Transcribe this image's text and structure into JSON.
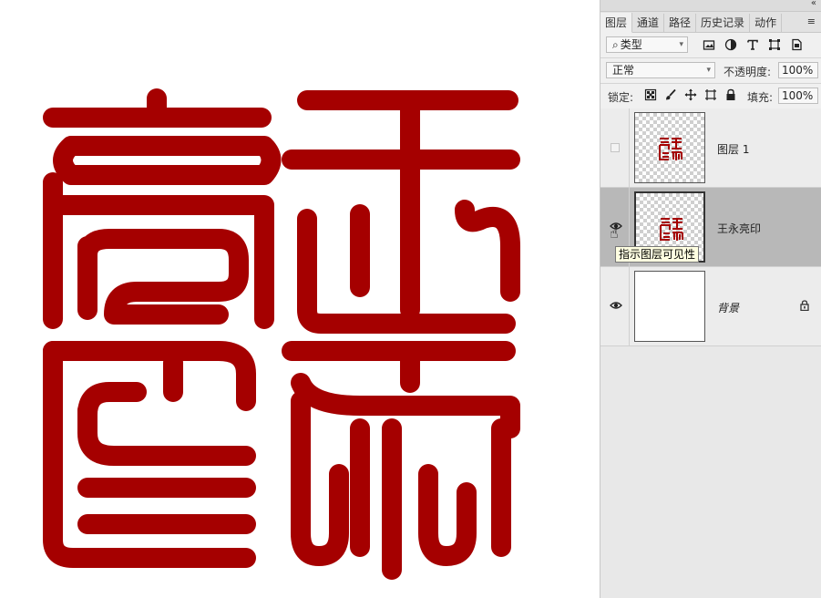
{
  "panel": {
    "collapse_icon": "«",
    "menu_icon": "≡",
    "tabs": [
      {
        "label": "图层",
        "active": true
      },
      {
        "label": "通道",
        "active": false
      },
      {
        "label": "路径",
        "active": false
      },
      {
        "label": "历史记录",
        "active": false
      },
      {
        "label": "动作",
        "active": false
      }
    ]
  },
  "filter": {
    "kind_label": "类型",
    "search_glyph": "⌕",
    "filter_icons": [
      "image-filter-icon",
      "adjustment-filter-icon",
      "type-filter-icon",
      "shape-filter-icon",
      "smart-object-filter-icon"
    ]
  },
  "blend": {
    "mode": "正常",
    "opacity_label": "不透明度:",
    "opacity_value": "100%"
  },
  "lock": {
    "label": "锁定:",
    "fill_label": "填充:",
    "fill_value": "100%"
  },
  "layers": [
    {
      "name": "图层 1",
      "visible": false,
      "selected": false
    },
    {
      "name": "王永亮印",
      "visible": true,
      "selected": true
    },
    {
      "name": "背景",
      "visible": true,
      "selected": false,
      "locked": true
    }
  ],
  "tooltip": "指示图层可见性",
  "colors": {
    "seal_red": "#a50000",
    "panel_bg": "#f0f0f0",
    "selected_layer": "#b8b8b8"
  }
}
